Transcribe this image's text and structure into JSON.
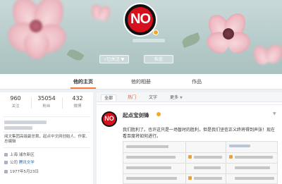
{
  "profile": {
    "avatar_text": "NO",
    "follow_button": "√已关注",
    "follow_arrow": "▼",
    "message_button": "私信"
  },
  "tabs": [
    {
      "label": "他的主页",
      "active": true
    },
    {
      "label": "他的相册",
      "active": false
    },
    {
      "label": "作品",
      "active": false
    }
  ],
  "stats": [
    {
      "value": "960",
      "label": "关注"
    },
    {
      "value": "35054",
      "label": "粉丝"
    },
    {
      "value": "432",
      "label": "微博"
    }
  ],
  "sidebar": {
    "bio": "阅文集团高级副总裁，起点中文网创始人、作家、总编辑",
    "location": "上海 浦东新区",
    "company_label": "公司",
    "company_value": "腾讯文学",
    "birthday": "1977年5月23日"
  },
  "filters": {
    "all": "全部",
    "hot": "热门",
    "text": "文字",
    "more": "更多"
  },
  "post": {
    "avatar_text": "NO",
    "author": "起点宝剑锋",
    "caret": "▼",
    "text": "我们胜利了。也许这只是一场暂时的胜利，但是我们坚信正义终将得到声张！现在看百度将如何进行。"
  },
  "colors": {
    "accent": "#f77c3d",
    "avatar_red": "#d6101c",
    "link": "#2a6fb4",
    "verified": "#f5a623"
  },
  "icons": [
    "verified-badge-icon",
    "location-icon",
    "company-icon",
    "birthday-icon",
    "chevron-down-icon"
  ]
}
